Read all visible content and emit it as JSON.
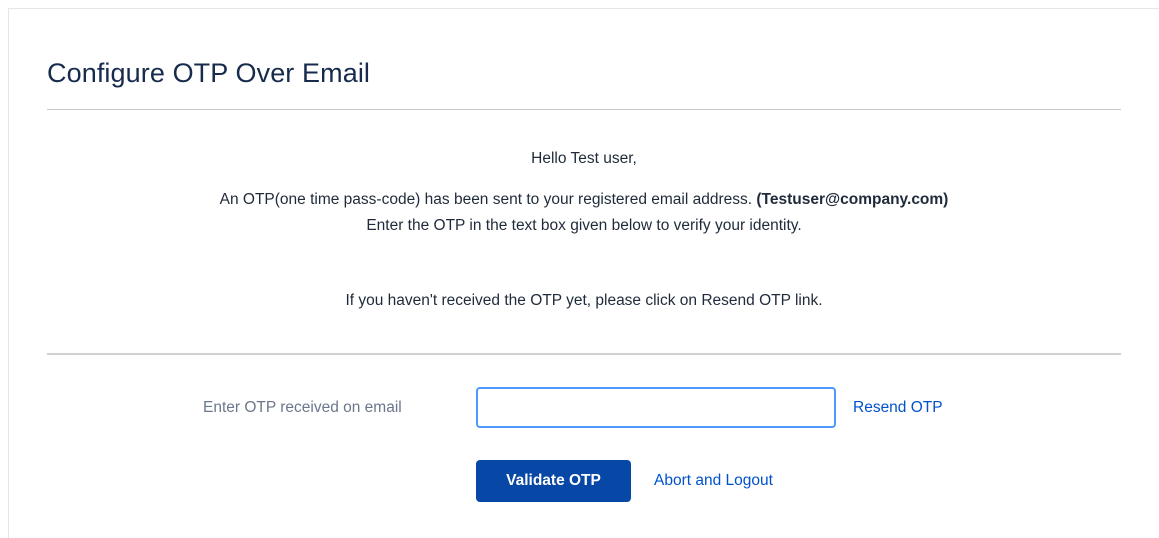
{
  "page": {
    "title": "Configure OTP Over Email"
  },
  "message": {
    "greeting": "Hello Test user,",
    "sent_text": "An OTP(one time pass-code) has been sent to your registered email address.",
    "email": "(Testuser@company.com)",
    "instruction": "Enter the OTP in the text box given below to verify your identity.",
    "resend_note": "If you haven't received the OTP yet, please click on Resend OTP link."
  },
  "form": {
    "otp_label": "Enter OTP received on email",
    "otp_value": "",
    "resend_link": "Resend OTP",
    "validate_button": "Validate OTP",
    "abort_link": "Abort and Logout"
  },
  "colors": {
    "primary_button": "#0747a6",
    "link": "#0052cc",
    "input_focus_border": "#4c9aff"
  }
}
